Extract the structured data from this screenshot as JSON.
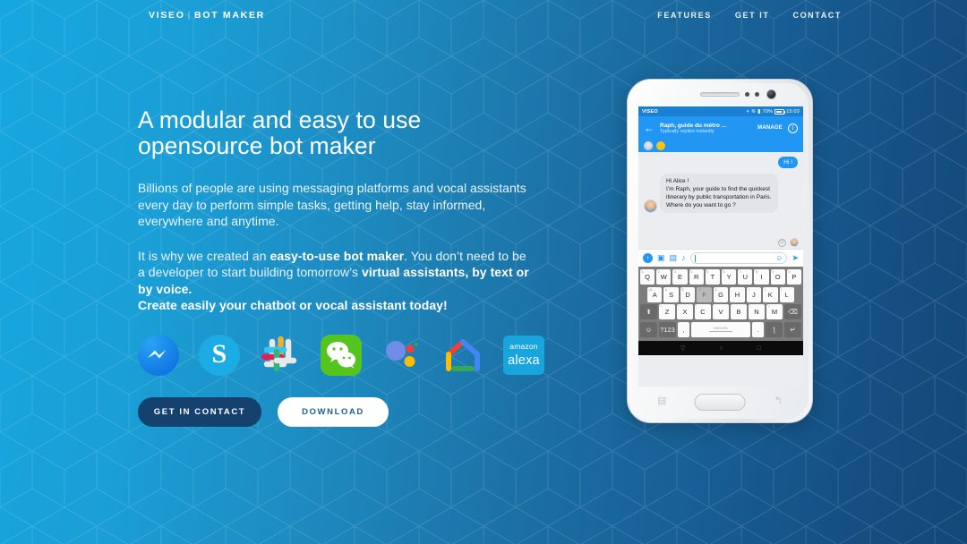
{
  "brand": {
    "logo_primary": "VISEO",
    "logo_separator": "|",
    "logo_secondary": "BOT MAKER",
    "accent_blue": "#1ba3dd",
    "dark_navy": "#134878",
    "button_dark": "#15416e"
  },
  "nav": {
    "items": [
      {
        "label": "FEATURES"
      },
      {
        "label": "GET IT"
      },
      {
        "label": "CONTACT"
      }
    ]
  },
  "hero": {
    "headline_line1": "A modular and easy to use",
    "headline_line2": "opensource bot maker",
    "paragraph1": "Billions of people are using messaging platforms and vocal assistants every day to perform simple tasks, getting help, stay informed, everywhere and anytime.",
    "paragraph2_part1": "It is why we created an ",
    "paragraph2_bold1": "easy-to-use bot maker",
    "paragraph2_part2": ". You don’t need to be a developer to start building tomorrow’s ",
    "paragraph2_bold2": "virtual assistants, by text or by voice.",
    "paragraph2_line3": "Create easily your chatbot or vocal assistant today!"
  },
  "platforms": [
    {
      "name": "messenger-icon",
      "label": "Messenger"
    },
    {
      "name": "skype-icon",
      "label": "S"
    },
    {
      "name": "slack-icon",
      "label": "Slack"
    },
    {
      "name": "wechat-icon",
      "label": "WeChat"
    },
    {
      "name": "google-assistant-icon",
      "label": "Google Assistant"
    },
    {
      "name": "google-home-icon",
      "label": "Google Home"
    },
    {
      "name": "amazon-alexa-icon",
      "label_top": "amazon",
      "label_bottom": "alexa"
    }
  ],
  "cta": {
    "contact_label": "GET IN CONTACT",
    "download_label": "DOWNLOAD"
  },
  "phone": {
    "statusbar": {
      "carrier": "VISEO",
      "battery": "70%",
      "clock": "15:03"
    },
    "chat_header": {
      "title": "Raph, guide du métro ...",
      "subtitle": "Typically replies instantly",
      "manage_label": "MANAGE",
      "info_label": "i"
    },
    "messages": [
      {
        "from": "user",
        "text": "Hi !"
      },
      {
        "from": "bot",
        "text": "Hi Alice !\nI’m Raph, your guide to find the quickest itinerary by public transportation in Paris.\nWhere do you want to go ?"
      }
    ],
    "input": {
      "value": "",
      "placeholder": "",
      "send_label": "➤"
    },
    "keyboard": {
      "row1": [
        {
          "key": "Q",
          "num": "1"
        },
        {
          "key": "W",
          "num": "2"
        },
        {
          "key": "E",
          "num": "3"
        },
        {
          "key": "R",
          "num": "4"
        },
        {
          "key": "T",
          "num": "5"
        },
        {
          "key": "Y",
          "num": "6"
        },
        {
          "key": "U",
          "num": "7"
        },
        {
          "key": "I",
          "num": "8"
        },
        {
          "key": "O",
          "num": "9"
        },
        {
          "key": "P",
          "num": "0"
        }
      ],
      "row2": [
        {
          "key": "A",
          "num": "@"
        },
        {
          "key": "S",
          "num": "#"
        },
        {
          "key": "D",
          "num": "$"
        },
        {
          "key": "F",
          "num": "%",
          "pressed": true
        },
        {
          "key": "G",
          "num": "&"
        },
        {
          "key": "H",
          "num": "-"
        },
        {
          "key": "J",
          "num": "+"
        },
        {
          "key": "K",
          "num": "("
        },
        {
          "key": "L",
          "num": ")"
        }
      ],
      "row3": [
        {
          "key": "⬆",
          "fn": true
        },
        {
          "key": "Z",
          "num": "*"
        },
        {
          "key": "X",
          "num": "\""
        },
        {
          "key": "C",
          "num": "'"
        },
        {
          "key": "V",
          "num": ":"
        },
        {
          "key": "B",
          "num": ";"
        },
        {
          "key": "N",
          "num": "!"
        },
        {
          "key": "M",
          "num": "?"
        },
        {
          "key": "⌫",
          "fn": true
        }
      ],
      "row4_emoji": "☺",
      "row4_symbols": "?123",
      "row4_comma": ",",
      "row4_space_label": "ENGLISH",
      "row4_period": ".",
      "row4_mic": "ƪ",
      "row4_enter": "↵"
    },
    "navbar": {
      "back": "▽",
      "home": "○",
      "recents": "□"
    }
  }
}
